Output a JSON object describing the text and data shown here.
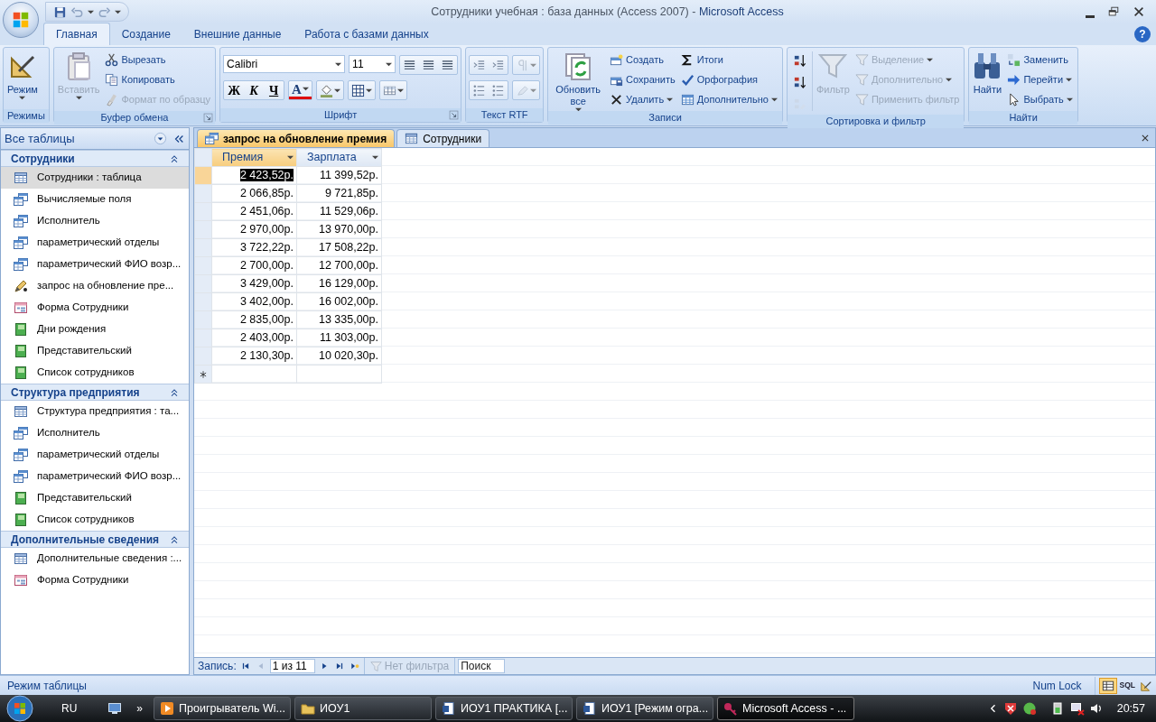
{
  "window": {
    "document_title": "Сотрудники учебная : база данных (Access 2007)",
    "separator": "-",
    "app_title": "Microsoft Access"
  },
  "ribbon_tabs": [
    {
      "label": "Главная",
      "selected": true
    },
    {
      "label": "Создание",
      "selected": false
    },
    {
      "label": "Внешние данные",
      "selected": false
    },
    {
      "label": "Работа с базами данных",
      "selected": false
    }
  ],
  "help_button": "?",
  "ribbon_groups": [
    {
      "label": "Режимы",
      "kind": "buttons",
      "launcher": false,
      "controls": [
        {
          "kind": "large",
          "label": "Режим",
          "disabled": false,
          "dropdown": true
        }
      ]
    },
    {
      "label": "Буфер обмена",
      "kind": "buttons",
      "launcher": true,
      "controls": [
        {
          "kind": "large",
          "label": "Вставить",
          "disabled": true,
          "dropdown": true
        },
        {
          "kind": "small",
          "label": "Вырезать",
          "disabled": false,
          "dropdown": false
        },
        {
          "kind": "small",
          "label": "Копировать",
          "disabled": false,
          "dropdown": false
        },
        {
          "kind": "small",
          "label": "Формат по образцу",
          "disabled": true,
          "dropdown": false
        }
      ]
    },
    {
      "label": "Шрифт",
      "kind": "font",
      "launcher": true,
      "controls": [
        {
          "kind": "combo",
          "value": "Calibri"
        },
        {
          "kind": "combo",
          "value": "11"
        },
        {
          "kind": "format",
          "label": "Ж"
        },
        {
          "kind": "format",
          "label": "К"
        },
        {
          "kind": "format",
          "label": "Ч"
        },
        {
          "kind": "color",
          "label": "A"
        }
      ]
    },
    {
      "label": "Текст RTF",
      "kind": "rtf",
      "launcher": false
    },
    {
      "label": "Записи",
      "kind": "buttons",
      "launcher": false,
      "controls": [
        {
          "kind": "large",
          "label": "Обновить все",
          "disabled": false,
          "dropdown": true
        },
        {
          "kind": "small",
          "label": "Создать",
          "disabled": false,
          "dropdown": false
        },
        {
          "kind": "small",
          "label": "Сохранить",
          "disabled": false,
          "dropdown": false
        },
        {
          "kind": "small",
          "label": "Удалить",
          "disabled": false,
          "dropdown": true
        },
        {
          "kind": "small",
          "label": "Итоги",
          "disabled": false,
          "dropdown": false
        },
        {
          "kind": "small",
          "label": "Орфография",
          "disabled": false,
          "dropdown": false
        },
        {
          "kind": "small",
          "label": "Дополнительно",
          "disabled": false,
          "dropdown": true
        }
      ]
    },
    {
      "label": "Сортировка и фильтр",
      "kind": "sort",
      "launcher": false,
      "controls": [
        {
          "kind": "large",
          "label": "Фильтр",
          "disabled": true,
          "dropdown": false
        },
        {
          "kind": "small",
          "label": "Выделение",
          "disabled": true,
          "dropdown": true
        },
        {
          "kind": "small",
          "label": "Дополнительно",
          "disabled": true,
          "dropdown": true
        },
        {
          "kind": "small",
          "label": "Применить фильтр",
          "disabled": true,
          "dropdown": false
        }
      ]
    },
    {
      "label": "Найти",
      "kind": "buttons",
      "launcher": false,
      "controls": [
        {
          "kind": "large",
          "label": "Найти",
          "disabled": false,
          "dropdown": false
        },
        {
          "kind": "small",
          "label": "Заменить",
          "disabled": false,
          "dropdown": false
        },
        {
          "kind": "small",
          "label": "Перейти",
          "disabled": false,
          "dropdown": true
        },
        {
          "kind": "small",
          "label": "Выбрать",
          "disabled": false,
          "dropdown": true
        }
      ]
    }
  ],
  "navigation_pane": {
    "title": "Все таблицы",
    "groups": [
      {
        "title": "Сотрудники",
        "expanded": true,
        "items": [
          {
            "label": "Сотрудники : таблица",
            "kind": "table",
            "selected": true
          },
          {
            "label": "Вычисляемые поля",
            "kind": "query",
            "selected": false
          },
          {
            "label": "Исполнитель",
            "kind": "query",
            "selected": false
          },
          {
            "label": "параметрический отделы",
            "kind": "query",
            "selected": false
          },
          {
            "label": "параметрический ФИО возр...",
            "kind": "query",
            "selected": false
          },
          {
            "label": "запрос на обновление пре...",
            "kind": "update",
            "selected": false
          },
          {
            "label": "Форма Сотрудники",
            "kind": "form",
            "selected": false
          },
          {
            "label": "Дни рождения",
            "kind": "report",
            "selected": false
          },
          {
            "label": "Представительский",
            "kind": "report",
            "selected": false
          },
          {
            "label": "Список сотрудников",
            "kind": "report",
            "selected": false
          }
        ]
      },
      {
        "title": "Структура предприятия",
        "expanded": true,
        "items": [
          {
            "label": "Структура предприятия : та...",
            "kind": "table",
            "selected": false
          },
          {
            "label": "Исполнитель",
            "kind": "query",
            "selected": false
          },
          {
            "label": "параметрический отделы",
            "kind": "query",
            "selected": false
          },
          {
            "label": "параметрический ФИО возр...",
            "kind": "query",
            "selected": false
          },
          {
            "label": "Представительский",
            "kind": "report",
            "selected": false
          },
          {
            "label": "Список сотрудников",
            "kind": "report",
            "selected": false
          }
        ]
      },
      {
        "title": "Дополнительные сведения",
        "expanded": true,
        "items": [
          {
            "label": "Дополнительные сведения :...",
            "kind": "table",
            "selected": false
          },
          {
            "label": "Форма Сотрудники",
            "kind": "form",
            "selected": false
          }
        ]
      }
    ]
  },
  "document_tabs": [
    {
      "label": "запрос на обновление премия",
      "kind": "query",
      "selected": true
    },
    {
      "label": "Сотрудники",
      "kind": "table",
      "selected": false
    }
  ],
  "datasheet": {
    "columns": [
      {
        "label": "Премия",
        "selected": true
      },
      {
        "label": "Зарплата",
        "selected": false
      }
    ],
    "rows": [
      {
        "cells": [
          "2 423,52р.",
          "11 399,52р."
        ],
        "selected": true
      },
      {
        "cells": [
          "2 066,85р.",
          "9 721,85р."
        ],
        "selected": false
      },
      {
        "cells": [
          "2 451,06р.",
          "11 529,06р."
        ],
        "selected": false
      },
      {
        "cells": [
          "2 970,00р.",
          "13 970,00р."
        ],
        "selected": false
      },
      {
        "cells": [
          "3 722,22р.",
          "17 508,22р."
        ],
        "selected": false
      },
      {
        "cells": [
          "2 700,00р.",
          "12 700,00р."
        ],
        "selected": false
      },
      {
        "cells": [
          "3 429,00р.",
          "16 129,00р."
        ],
        "selected": false
      },
      {
        "cells": [
          "3 402,00р.",
          "16 002,00р."
        ],
        "selected": false
      },
      {
        "cells": [
          "2 835,00р.",
          "13 335,00р."
        ],
        "selected": false
      },
      {
        "cells": [
          "2 403,00р.",
          "11 303,00р."
        ],
        "selected": false
      },
      {
        "cells": [
          "2 130,30р.",
          "10 020,30р."
        ],
        "selected": false
      }
    ]
  },
  "record_navigator": {
    "label": "Запись:",
    "position": "1 из 11",
    "filter": "Нет фильтра",
    "filter_disabled": true,
    "search_placeholder": "Поиск"
  },
  "status_bar": {
    "mode": "Режим таблицы",
    "num_lock": "Num Lock",
    "views": [
      {
        "kind": "datasheet",
        "selected": true
      },
      {
        "kind": "sql",
        "label": "SQL",
        "selected": false
      },
      {
        "kind": "design",
        "selected": false
      }
    ]
  },
  "taskbar": {
    "language": "RU",
    "overflow": "»",
    "tasks": [
      {
        "label": "Проигрыватель Wi...",
        "kind": "player",
        "selected": false
      },
      {
        "label": "ИОУ1",
        "kind": "folder",
        "selected": false
      },
      {
        "label": "ИОУ1 ПРАКТИКА [...",
        "kind": "document",
        "selected": false
      },
      {
        "label": "ИОУ1 [Режим огра...",
        "kind": "document",
        "selected": false
      },
      {
        "label": "Microsoft Access - ...",
        "kind": "access",
        "selected": true
      }
    ],
    "clock": "20:57"
  }
}
